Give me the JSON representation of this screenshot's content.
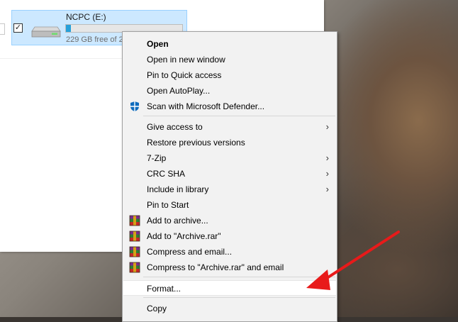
{
  "drive": {
    "name": "NCPC (E:)",
    "free_text": "229 GB free of 2",
    "checkbox_state": "✓",
    "used_fraction": 0.04,
    "icon": "hard-drive-icon"
  },
  "menu": {
    "items": [
      {
        "label": "Open",
        "bold": true
      },
      {
        "label": "Open in new window"
      },
      {
        "label": "Pin to Quick access"
      },
      {
        "label": "Open AutoPlay..."
      },
      {
        "label": "Scan with Microsoft Defender...",
        "icon": "defender-shield-icon"
      },
      {
        "label": "Give access to",
        "submenu": true
      },
      {
        "label": "Restore previous versions"
      },
      {
        "label": "7-Zip",
        "submenu": true
      },
      {
        "label": "CRC SHA",
        "submenu": true
      },
      {
        "label": "Include in library",
        "submenu": true
      },
      {
        "label": "Pin to Start"
      },
      {
        "label": "Add to archive...",
        "icon": "winrar-icon"
      },
      {
        "label": "Add to \"Archive.rar\"",
        "icon": "winrar-icon"
      },
      {
        "label": "Compress and email...",
        "icon": "winrar-icon"
      },
      {
        "label": "Compress to \"Archive.rar\" and email",
        "icon": "winrar-icon"
      },
      {
        "label": "Format..."
      },
      {
        "label": "Copy"
      }
    ],
    "chevron": "›"
  },
  "annotation": {
    "color": "#e81a1a"
  }
}
